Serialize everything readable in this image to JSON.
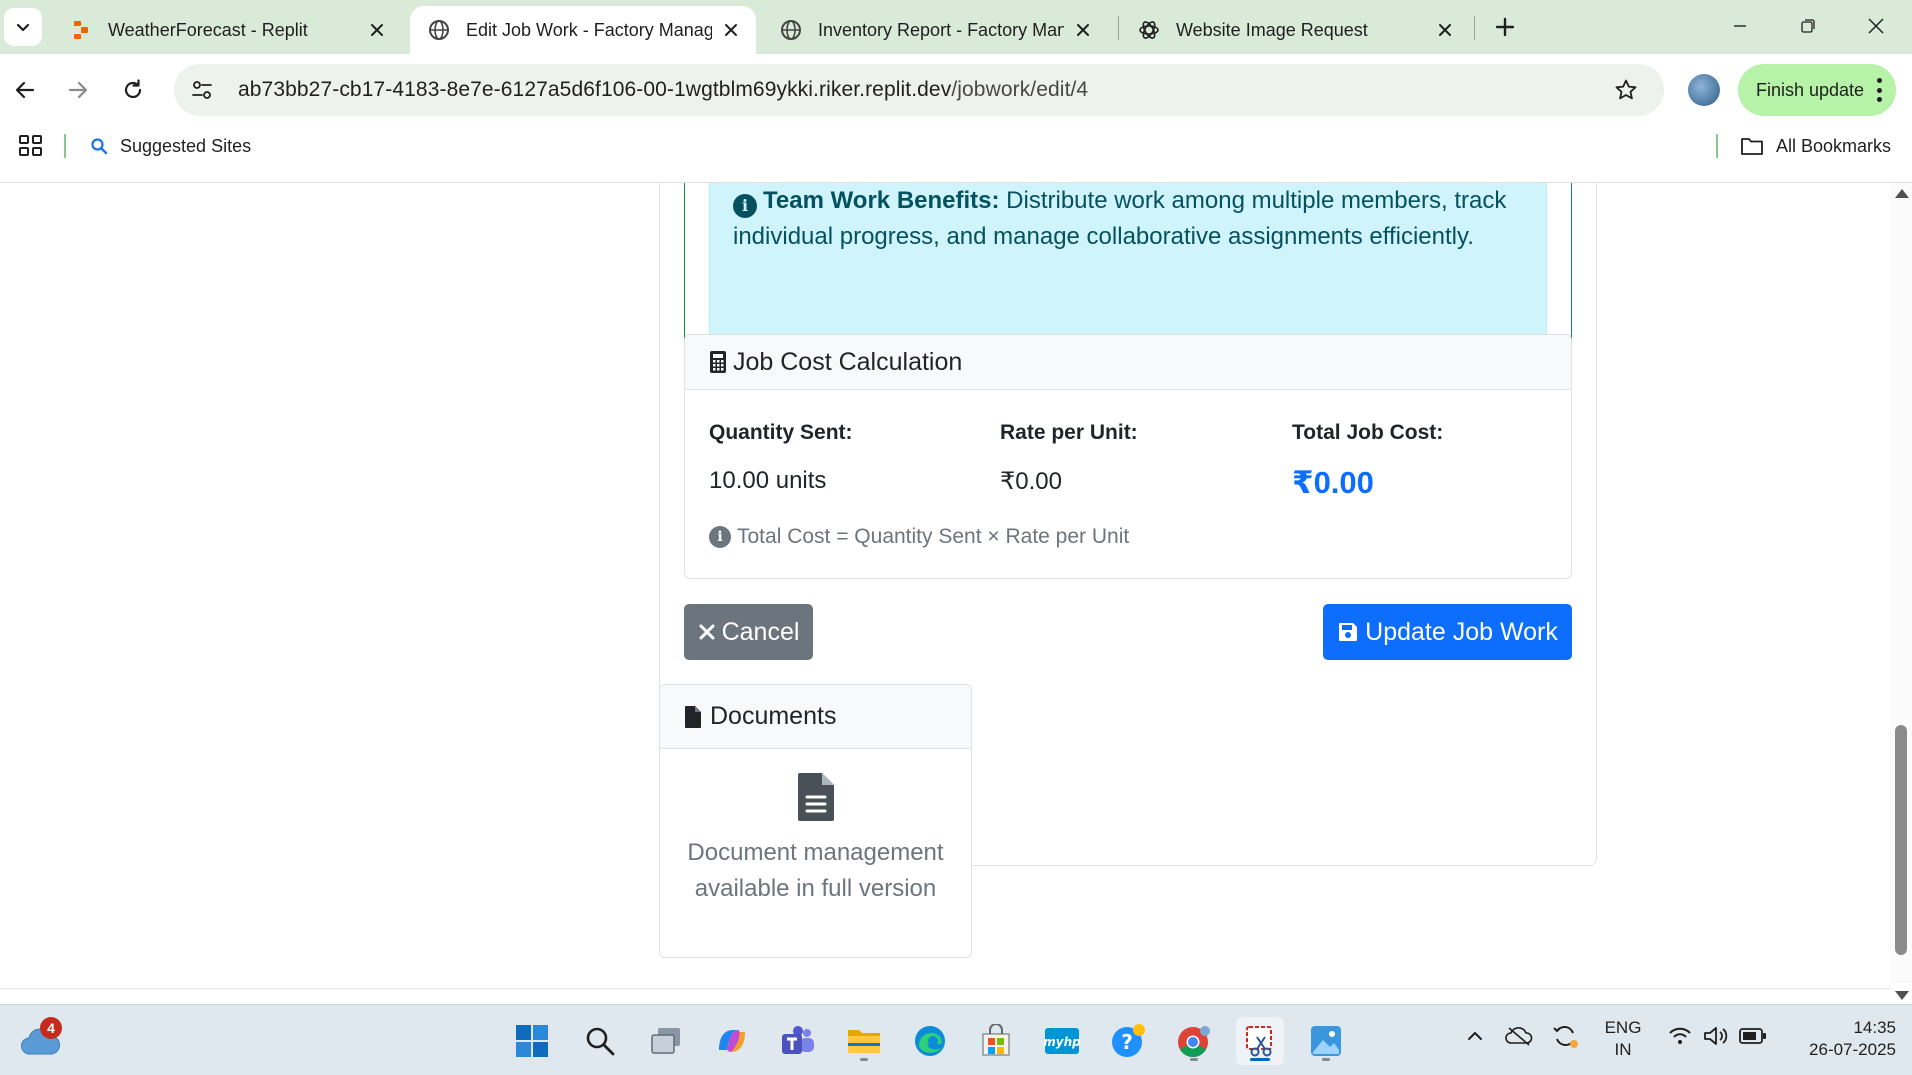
{
  "browser": {
    "tabs": [
      {
        "title": "WeatherForecast - Replit",
        "favicon": "replit-icon",
        "active": false
      },
      {
        "title": "Edit Job Work - Factory Manage",
        "favicon": "globe-icon",
        "active": true
      },
      {
        "title": "Inventory Report - Factory Man",
        "favicon": "globe-icon",
        "active": false
      },
      {
        "title": "Website Image Request",
        "favicon": "openai-icon",
        "active": false
      }
    ],
    "url_host": "ab73bb27-cb17-4183-8e7e-6127a5d6f106-00-1wgtblm69ykki.riker.replit.dev",
    "url_path": "/jobwork/edit/4",
    "finish_update_label": "Finish update",
    "bookmarks": {
      "suggested_sites": "Suggested Sites",
      "all_bookmarks": "All Bookmarks"
    }
  },
  "page": {
    "team_work": {
      "title": "Team Work Benefits:",
      "text": " Distribute work among multiple members, track individual progress, and manage collaborative assignments efficiently."
    },
    "job_cost": {
      "title": "Job Cost Calculation",
      "quantity_label": "Quantity Sent:",
      "quantity_value": "10.00 units",
      "rate_label": "Rate per Unit:",
      "rate_value": "₹0.00",
      "total_label": "Total Job Cost:",
      "total_value": "₹0.00",
      "formula_note": "Total Cost = Quantity Sent × Rate per Unit"
    },
    "buttons": {
      "cancel": "Cancel",
      "update": "Update Job Work"
    },
    "documents": {
      "title": "Documents",
      "message": "Document management available in full version"
    }
  },
  "taskbar": {
    "weather_badge": "4",
    "language": "ENG",
    "region": "IN",
    "time": "14:35",
    "date": "26-07-2025"
  },
  "colors": {
    "primary": "#0d6efd",
    "secondary": "#6c757d",
    "success_border": "#198754",
    "info_bg": "#cff4fc",
    "info_text": "#055160",
    "tabbar_bg": "#d9ebd8",
    "finish_update_bg": "#b6f2a8"
  }
}
